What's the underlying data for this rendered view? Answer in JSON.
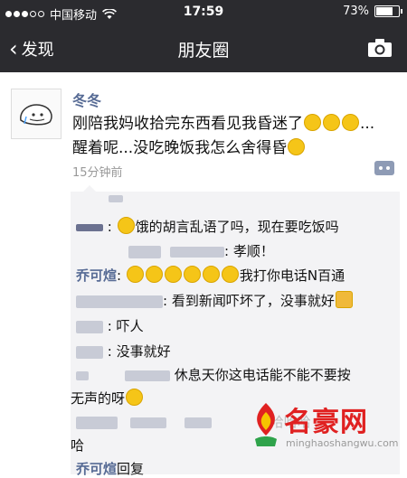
{
  "status": {
    "carrier": "中国移动",
    "time": "17:59",
    "battery": "73%",
    "battery_level": 0.73
  },
  "nav": {
    "back_label": "发现",
    "title": "朋友圈"
  },
  "post": {
    "author": "冬冬",
    "text_line1": "刚陪我妈收拾完东西看见我昏迷了",
    "text_line1_tail": "...",
    "text_line2": "醒着呢...没吃晚饭我怎么舍得昏",
    "time": "15分钟前"
  },
  "comments": [
    {
      "text": "饿的胡言乱语了吗，现在要吃饭吗"
    },
    {
      "text": "孝顺！"
    },
    {
      "name": "乔可煊",
      "text": "我打你电话N百通"
    },
    {
      "text": "看到新闻吓坏了，没事就好"
    },
    {
      "text": "吓人"
    },
    {
      "text": "没事就好"
    },
    {
      "text": "休息天你这电话能不能不要按"
    },
    {
      "text": "无声的呀"
    },
    {
      "text": "哈哈哈"
    },
    {
      "text": "哈"
    },
    {
      "name": "乔可煊",
      "text": "回复"
    }
  ],
  "watermark": {
    "text": "名豪网",
    "url": "minghaoshangwu.com"
  },
  "colors": {
    "bar": "#2b2b2f",
    "link": "#576b95",
    "comment_bg": "#f3f3f5",
    "watermark": "#e02121"
  }
}
